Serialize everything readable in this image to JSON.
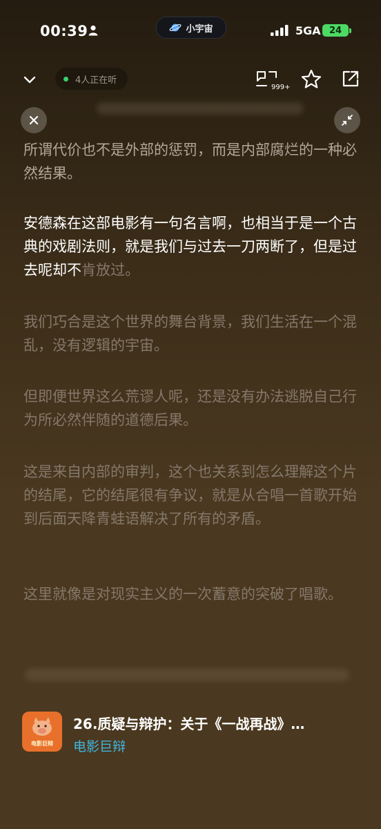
{
  "status_bar": {
    "time": "00:39",
    "network": "5GA",
    "battery": "24"
  },
  "dynamic_island": {
    "label": "小宇宙"
  },
  "header": {
    "listeners": "4人正在听",
    "comment_count": "999+"
  },
  "lyrics": [
    {
      "text": "所谓代价也不是外部的惩罚，而是内部腐烂的一种必然结果。",
      "state": "past"
    },
    {
      "text_bright": "安德森在这部电影有一句名言啊，也相当于是一个古典的戏剧法则，就是我们与过去一刀两断了，但是过去呢却不",
      "text_dim": "肯放过。",
      "state": "current"
    },
    {
      "text": "我们巧合是这个世界的舞台背景，我们生活在一个混乱，没有逻辑的宇宙。",
      "state": "future"
    },
    {
      "text": "但即便世界这么荒谬人呢，还是没有办法逃脱自己行为所必然伴随的道德后果。",
      "state": "future"
    },
    {
      "text": "这是来自内部的审判，这个也关系到怎么理解这个片的结尾，它的结尾很有争议，就是从合唱一首歌开始到后面天降青蛙语解决了所有的矛盾。",
      "state": "future"
    },
    {
      "text": "这里就像是对现实主义的一次蓄意的突破了唱歌。",
      "state": "future"
    }
  ],
  "now_playing": {
    "cover_label": "电影巨辩",
    "title": "26.质疑与辩护：关于《一战再战》…",
    "podcast": "电影巨辩"
  },
  "colors": {
    "accent": "#3fb6e0",
    "live_dot": "#38d26a",
    "battery": "#4cd964"
  }
}
